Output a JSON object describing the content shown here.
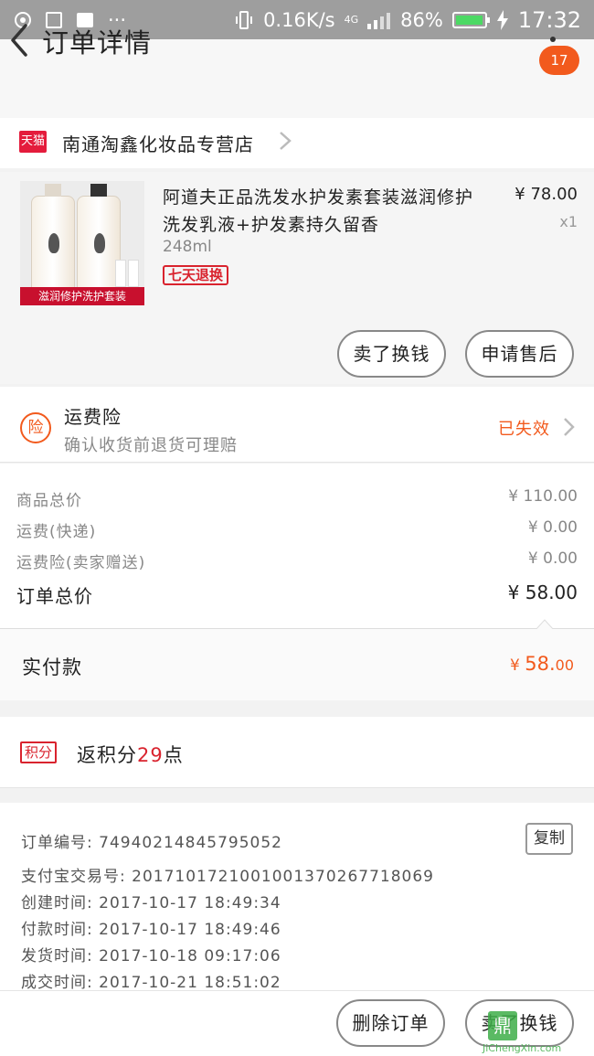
{
  "status_bar": {
    "network_speed": "0.16K/s",
    "network_type": "4G",
    "battery_percent": "86%",
    "time": "17:32",
    "more_glyph": "···"
  },
  "header": {
    "title": "订单详情",
    "badge_count": "17"
  },
  "shop": {
    "tmall_label": "天猫",
    "name": "南通淘鑫化妆品专营店"
  },
  "product": {
    "title": "阿道夫正品洗发水护发素套装滋润修护洗发乳液+护发素持久留香",
    "spec": "248ml",
    "return_tag": "七天退换",
    "price": "¥ 78.00",
    "quantity": "x1",
    "image_banner": "滋润修护洗护套装"
  },
  "actions": {
    "sell_label": "卖了换钱",
    "aftersale_label": "申请售后"
  },
  "insurance": {
    "icon_label": "险",
    "title": "运费险",
    "subtitle": "确认收货前退货可理赔",
    "status": "已失效"
  },
  "summary": {
    "goods_total_label": "商品总价",
    "goods_total_value": "¥ 110.00",
    "shipping_label": "运费(快递)",
    "shipping_value": "¥ 0.00",
    "insurance_label": "运费险(卖家赠送)",
    "insurance_value": "¥ 0.00",
    "order_total_label": "订单总价",
    "order_total_value": "¥ 58.00"
  },
  "paid": {
    "label": "实付款",
    "currency": "¥ ",
    "amount_main": "58.",
    "amount_cents": "00"
  },
  "points": {
    "tag": "积分",
    "prefix": "返积分",
    "number": "29",
    "suffix": "点"
  },
  "order_info": {
    "order_no": "订单编号: 74940214845795052",
    "alipay_no": "支付宝交易号: 2017101721001001370267718069",
    "created": "创建时间: 2017-10-17 18:49:34",
    "paid": "付款时间: 2017-10-17 18:49:46",
    "shipped": "发货时间: 2017-10-18 09:17:06",
    "completed": "成交时间: 2017-10-21 18:51:02",
    "copy_label": "复制"
  },
  "footer": {
    "delete_label": "删除订单",
    "sell_label": "卖了换钱"
  },
  "watermark": {
    "glyph": "鼎",
    "text": "JiChengXin.com"
  },
  "colors": {
    "accent": "#f25a1d",
    "tmall_red": "#e41c3c",
    "tag_red": "#d9232e"
  }
}
